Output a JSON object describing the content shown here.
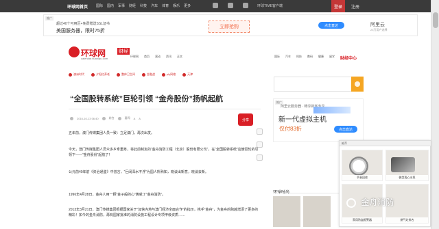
{
  "topbar": {
    "site": "环球网首页",
    "nav": [
      "国际",
      "国内",
      "军事",
      "财经",
      "科技",
      "汽车",
      "体育",
      "娱乐",
      "更多"
    ],
    "app_label": "环球TIME客户端",
    "login": "登录",
    "register": "注册"
  },
  "top_ad": {
    "tag": "推广",
    "line1": "超过40个可用区+免费赠送SSL证书",
    "line2": "美国服务器，限时75折",
    "cta": "立即抢购",
    "pill": "点击直达",
    "brand": "阿里云",
    "brand_sub": "23万用户选择"
  },
  "site": {
    "logo": "环球网",
    "badge": "财经",
    "sub": "calendar.huanqiu.com"
  },
  "channel_nav": [
    "环球网",
    "首页",
    "滚动",
    "资讯",
    "正文"
  ],
  "right_nav": [
    "国际",
    "汽车",
    "科技",
    "数码",
    "健康",
    "留学",
    "财经中心"
  ],
  "subnav": [
    "澳洲时代",
    "夕阳红养老",
    "整体卫生间",
    "金融战",
    "ply网络",
    "天津"
  ],
  "article": {
    "title": "“全国股转系统”巨轮引领 “金舟股份”扬帆起航",
    "meta": [
      "2016-10-13 06:40",
      "综合",
      "要闻",
      "A",
      "A"
    ],
    "share": "分享",
    "paragraphs": [
      "五年前，澳门传媒集团人员一致：立足澳门，再次出发。",
      "今天，澳门传媒集团人员众多乡拿重筹，将此前制定的“金舟消防工程（北京）股份有限公司”，在“全国股转系统”这艘巨轮的引领下——“金舟股份”起航了！",
      "公元前40年前《资治通鉴》中曾言，“巨阔深水不浮”为国人所熟知，晓谈出新意，晓谈去新。",
      "1996年4月28日，金舟人用一颗“金子般的心”铸就了“金舟消防”。",
      "2013年3月21日，澳门传媒集团根据国家关于“加快内地与澳门经济全面合作”的指示，携手“金舟”，为金舟的跨越增添了更多的精彩！如今的金舟消防，再有国家批准的消防设施工程设计专项甲级资质……"
    ]
  },
  "right_ad": {
    "tag": "推广",
    "t1": "阿里云服务器 · 畅享新客专享",
    "t2": "新一代虚拟主机",
    "t3": "仅付83折",
    "btn": "点击直达"
  },
  "sidebar": {
    "section_title": "环球时尚"
  },
  "popup": {
    "header": "推荐",
    "items": [
      "手表回收",
      "微型离心水泵",
      "家用防盗报警器",
      "燃气灶排名"
    ]
  },
  "watermark": "金舟消防"
}
